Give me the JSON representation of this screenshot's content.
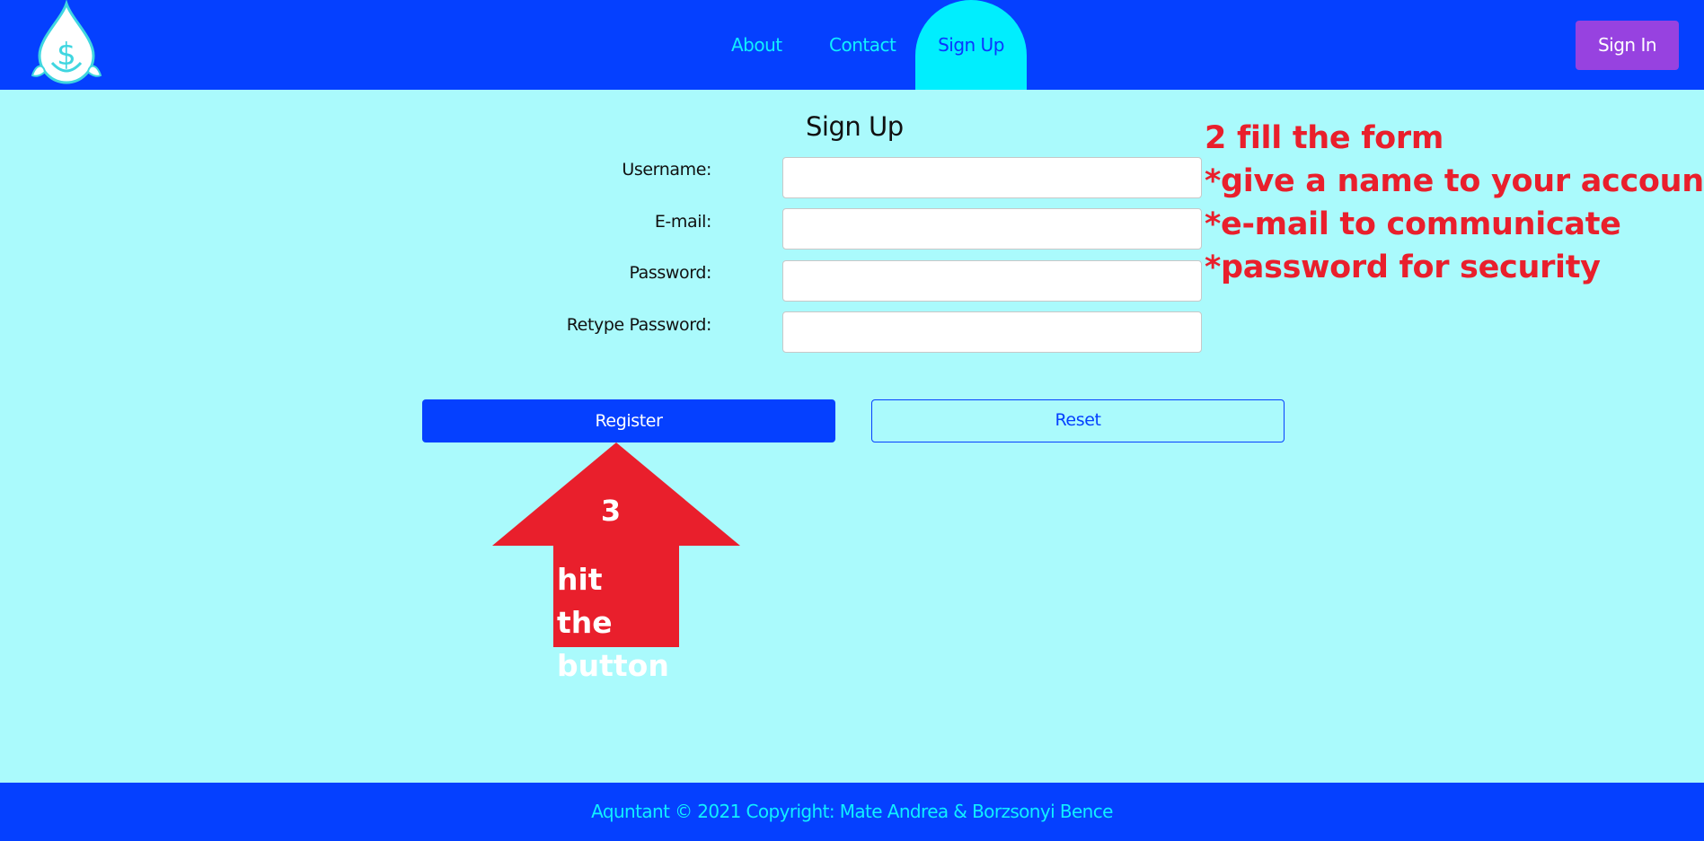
{
  "colors": {
    "page_background": "#aafafc",
    "navbar": "#0540ff",
    "nav_link": "#10f0ff",
    "active_tab": "#00eefe",
    "signin_button": "#9742e0",
    "register_button": "#0540ff",
    "annotation": "#e91f2c"
  },
  "header": {
    "logo_icon": "water-drop-dollar-icon",
    "nav": {
      "about": "About",
      "contact": "Contact",
      "signup": "Sign Up"
    },
    "signin_label": "Sign In"
  },
  "form": {
    "title": "Sign Up",
    "fields": {
      "username": {
        "label": "Username:",
        "value": ""
      },
      "email": {
        "label": "E-mail:",
        "value": ""
      },
      "password": {
        "label": "Password:",
        "value": ""
      },
      "retype": {
        "label": "Retype Password:",
        "value": ""
      }
    },
    "register_label": "Register",
    "reset_label": "Reset"
  },
  "annotations": {
    "form_note": [
      "2 fill the form",
      "*give a name to your account",
      "*e-mail to communicate",
      "*password for security"
    ],
    "arrow_number": "3",
    "arrow_text": "hit the button"
  },
  "footer": {
    "copyright": "Aquntant © 2021 Copyright: Mate Andrea &  Borzsonyi Bence"
  }
}
